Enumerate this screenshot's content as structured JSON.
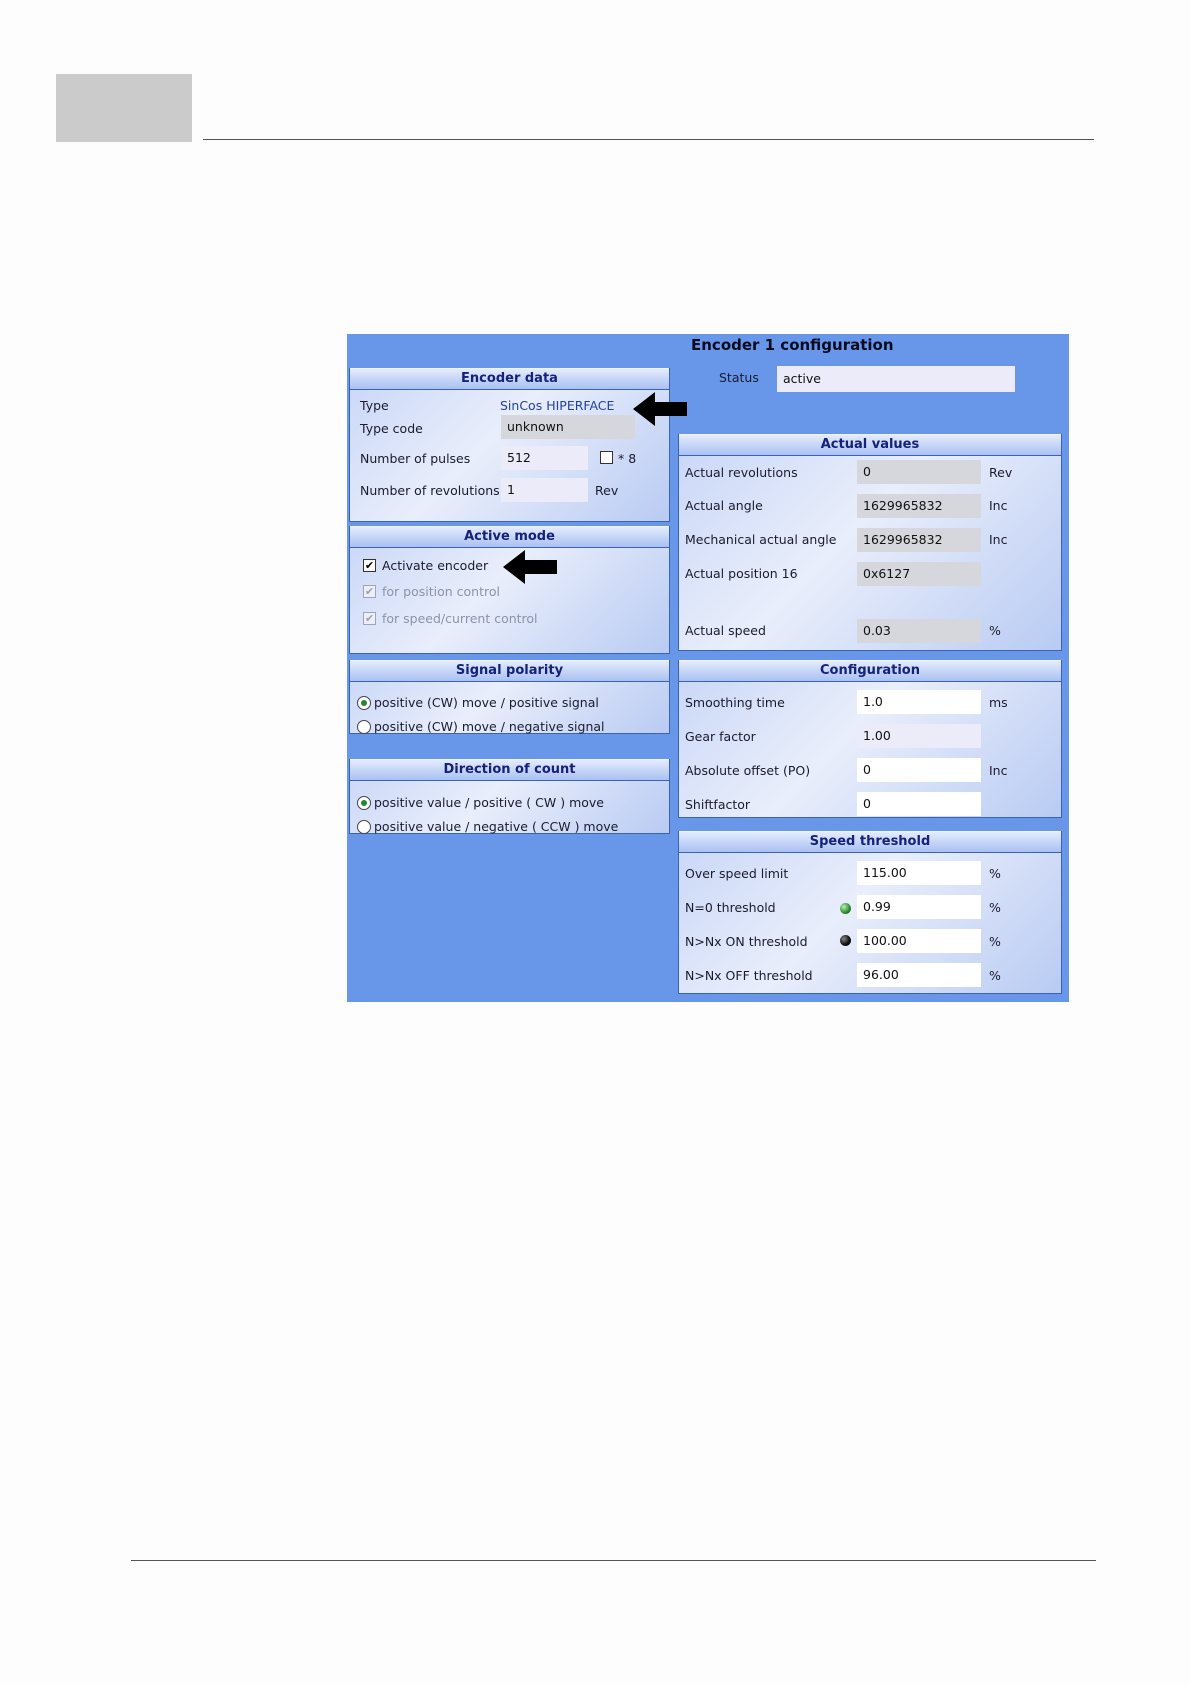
{
  "window": {
    "title": "Encoder 1 configuration"
  },
  "status": {
    "label": "Status",
    "value": "active"
  },
  "encoder_data": {
    "title": "Encoder data",
    "type_label": "Type",
    "type_value": "SinCos HIPERFACE",
    "type_code_label": "Type code",
    "type_code_value": "unknown",
    "pulses_label": "Number of pulses",
    "pulses_value": "512",
    "x8_label": "* 8",
    "x8_checked": false,
    "revs_label": "Number of revolutions",
    "revs_value": "1",
    "revs_unit": "Rev"
  },
  "active_mode": {
    "title": "Active mode",
    "activate_label": "Activate encoder",
    "activate_checked": true,
    "position_label": "for position control",
    "speed_label": "for speed/current control"
  },
  "signal_polarity": {
    "title": "Signal polarity",
    "options": [
      "positive (CW) move / positive signal",
      "positive (CW) move / negative signal"
    ],
    "selected": 0
  },
  "direction_of_count": {
    "title": "Direction of count",
    "options": [
      "positive value / positive ( CW ) move",
      "positive value / negative ( CCW ) move"
    ],
    "selected": 0
  },
  "actual_values": {
    "title": "Actual values",
    "rows": [
      {
        "label": "Actual revolutions",
        "value": "0",
        "unit": "Rev"
      },
      {
        "label": "Actual angle",
        "value": "1629965832",
        "unit": "Inc"
      },
      {
        "label": "Mechanical actual angle",
        "value": "1629965832",
        "unit": "Inc"
      },
      {
        "label": "Actual position 16",
        "value": "0x6127",
        "unit": ""
      },
      {
        "label": "Actual speed",
        "value": "0.03",
        "unit": "%"
      }
    ]
  },
  "configuration": {
    "title": "Configuration",
    "rows": [
      {
        "label": "Smoothing time",
        "value": "1.0",
        "unit": "ms"
      },
      {
        "label": "Gear factor",
        "value": "1.00",
        "unit": ""
      },
      {
        "label": "Absolute offset (PO)",
        "value": "0",
        "unit": "Inc"
      },
      {
        "label": "Shiftfactor",
        "value": "0",
        "unit": ""
      }
    ]
  },
  "speed_threshold": {
    "title": "Speed threshold",
    "rows": [
      {
        "label": "Over speed limit",
        "value": "115.00",
        "unit": "%",
        "led": ""
      },
      {
        "label": "N=0 threshold",
        "value": "0.99",
        "unit": "%",
        "led": "green"
      },
      {
        "label": "N>Nx ON threshold",
        "value": "100.00",
        "unit": "%",
        "led": "black"
      },
      {
        "label": "N>Nx OFF threshold",
        "value": "96.00",
        "unit": "%",
        "led": ""
      }
    ]
  },
  "icons": {
    "pointer_arrows": "left-arrow-icon",
    "led_on": "#2b8a2b",
    "led_off": "#111111"
  },
  "colors": {
    "window_bg": "#6897ea",
    "panel_title_text": "#14227a"
  }
}
